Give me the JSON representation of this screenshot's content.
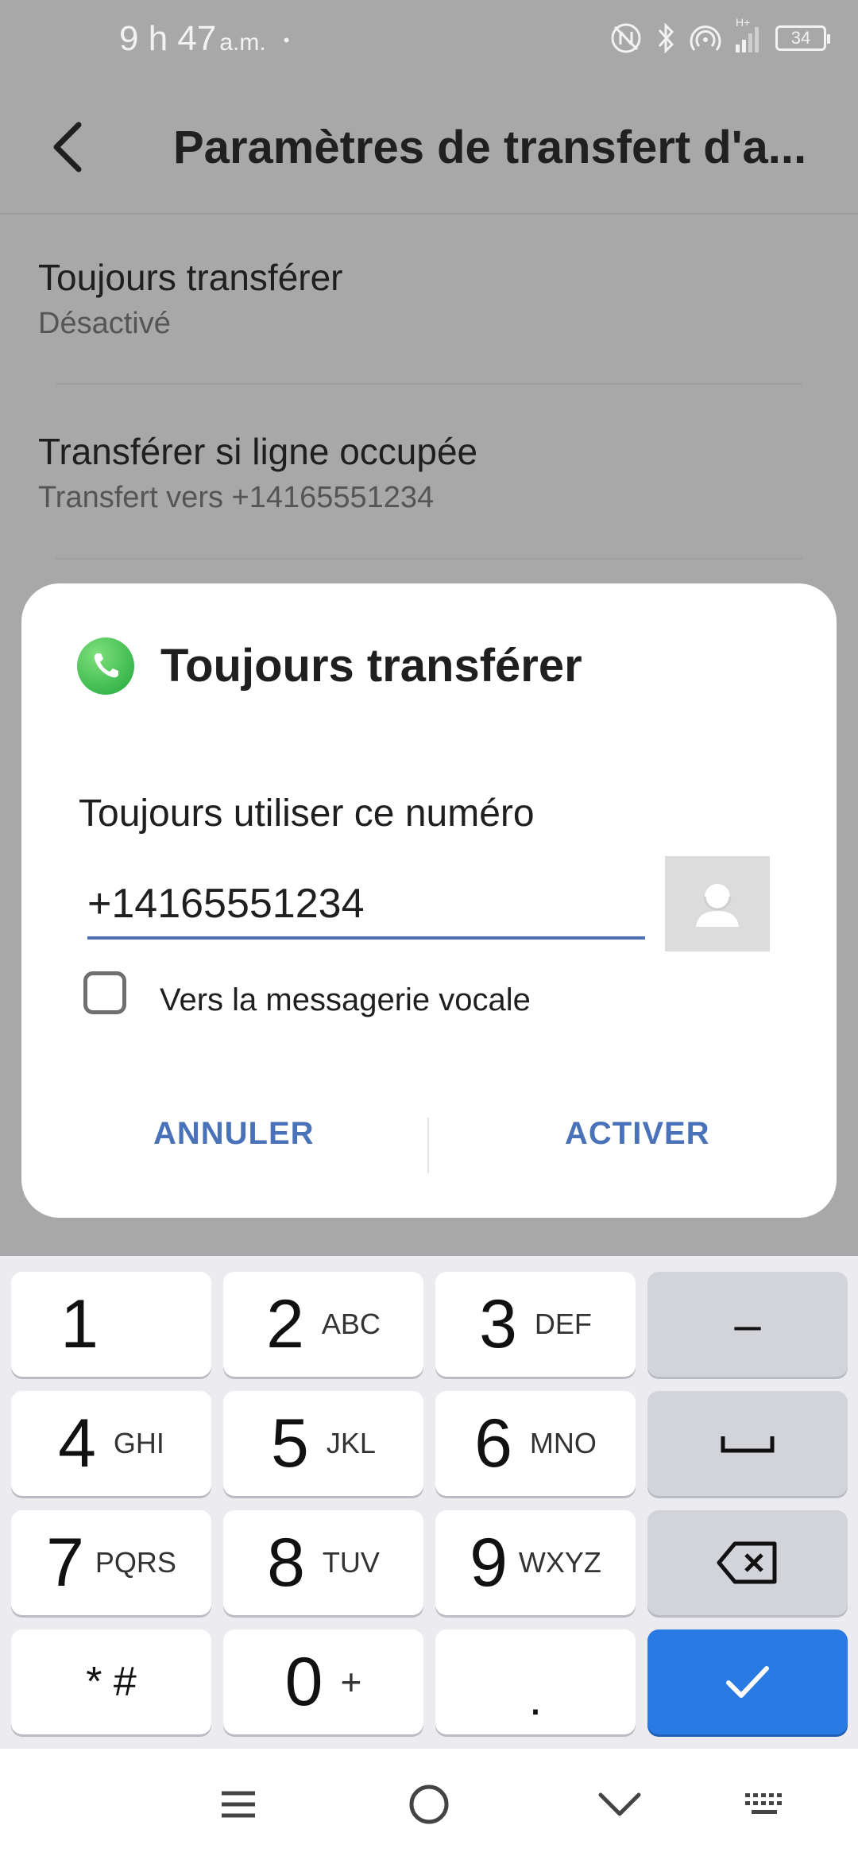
{
  "status_bar": {
    "time": "9 h 47",
    "ampm": "a.m.",
    "dot": "•",
    "network": "H+",
    "battery": "34"
  },
  "app_bar": {
    "title": "Paramètres de transfert d'a..."
  },
  "settings": [
    {
      "title": "Toujours transférer",
      "subtitle": "Désactivé"
    },
    {
      "title": "Transférer si ligne occupée",
      "subtitle": "Transfert vers +14165551234"
    }
  ],
  "dialog": {
    "title": "Toujours transférer",
    "label": "Toujours utiliser ce numéro",
    "number_value": "+14165551234",
    "checkbox_label": "Vers la messagerie vocale",
    "checkbox_checked": false,
    "cancel_label": "ANNULER",
    "ok_label": "ACTIVER"
  },
  "keypad": {
    "keys": [
      {
        "main": "1",
        "letters": ""
      },
      {
        "main": "2",
        "letters": "ABC"
      },
      {
        "main": "3",
        "letters": "DEF"
      },
      {
        "main": "–",
        "letters": ""
      },
      {
        "main": "4",
        "letters": "GHI"
      },
      {
        "main": "5",
        "letters": "JKL"
      },
      {
        "main": "6",
        "letters": "MNO"
      },
      {
        "main": "7",
        "letters": "PQRS"
      },
      {
        "main": "8",
        "letters": "TUV"
      },
      {
        "main": "9",
        "letters": "WXYZ"
      },
      {
        "main": "* #",
        "letters": ""
      },
      {
        "main": "0",
        "letters": "+"
      },
      {
        "main": ".",
        "letters": ""
      }
    ]
  },
  "colors": {
    "accent": "#4a72b8",
    "keypad_confirm": "#2a7ae3",
    "phone_icon": "#1fa83b"
  }
}
